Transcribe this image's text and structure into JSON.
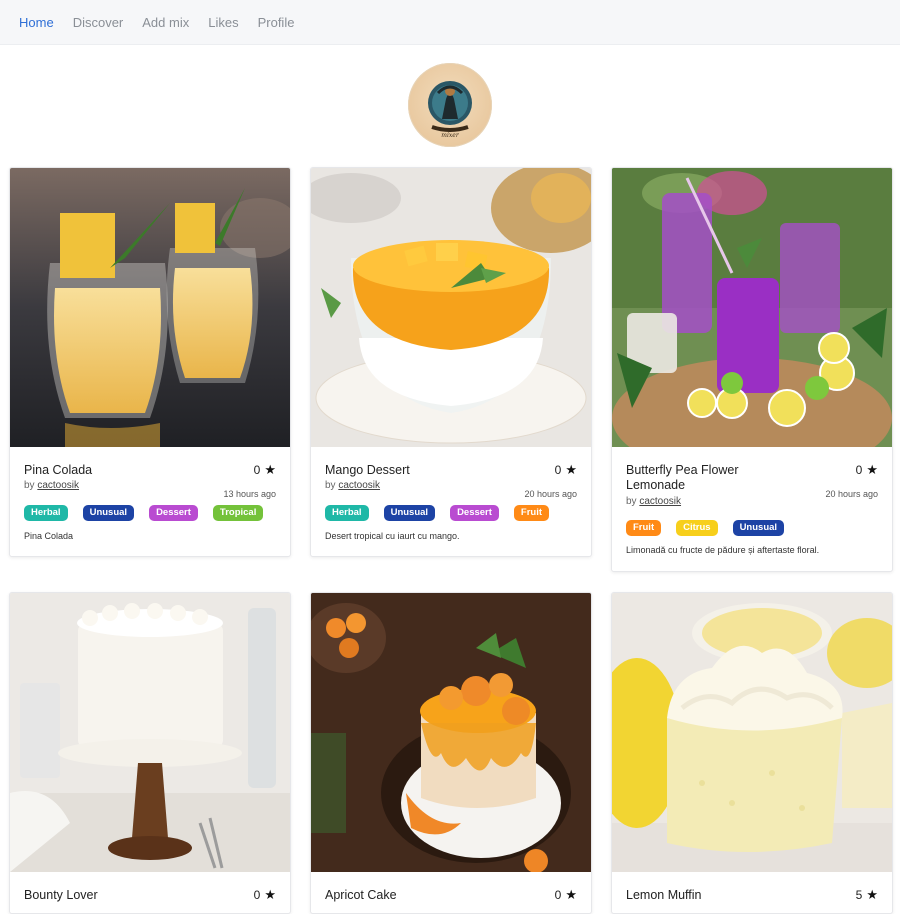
{
  "nav": {
    "items": [
      {
        "label": "Home",
        "active": true
      },
      {
        "label": "Discover"
      },
      {
        "label": "Add mix"
      },
      {
        "label": "Likes"
      },
      {
        "label": "Profile"
      }
    ]
  },
  "logo": {
    "icon": "brand-logo-icon"
  },
  "colors": {
    "Herbal": "#1fb8a7",
    "Unusual": "#1d43a5",
    "Dessert": "#b94bd1",
    "Tropical": "#74c23a",
    "Fruit": "#ff8a16",
    "Citrus": "#f7cf1b"
  },
  "cards": [
    {
      "title": "Pina Colada",
      "by": "by",
      "author": "cactoosik",
      "likes": "0",
      "time": "13 hours ago",
      "tags": [
        "Herbal",
        "Unusual",
        "Dessert",
        "Tropical"
      ],
      "desc": "Pina Colada"
    },
    {
      "title": "Mango Dessert",
      "by": "by",
      "author": "cactoosik",
      "likes": "0",
      "time": "20 hours ago",
      "tags": [
        "Herbal",
        "Unusual",
        "Dessert",
        "Fruit"
      ],
      "desc": "Desert tropical cu iaurt cu mango."
    },
    {
      "title": "Butterfly Pea Flower Lemonade",
      "by": "by",
      "author": "cactoosik",
      "likes": "0",
      "time": "20 hours ago",
      "tags": [
        "Fruit",
        "Citrus",
        "Unusual"
      ],
      "desc": "Limonadă cu fructe de pădure și aftertaste floral."
    },
    {
      "title": "Bounty Lover",
      "likes": "0"
    },
    {
      "title": "Apricot Cake",
      "likes": "0"
    },
    {
      "title": "Lemon Muffin",
      "likes": "5"
    }
  ]
}
